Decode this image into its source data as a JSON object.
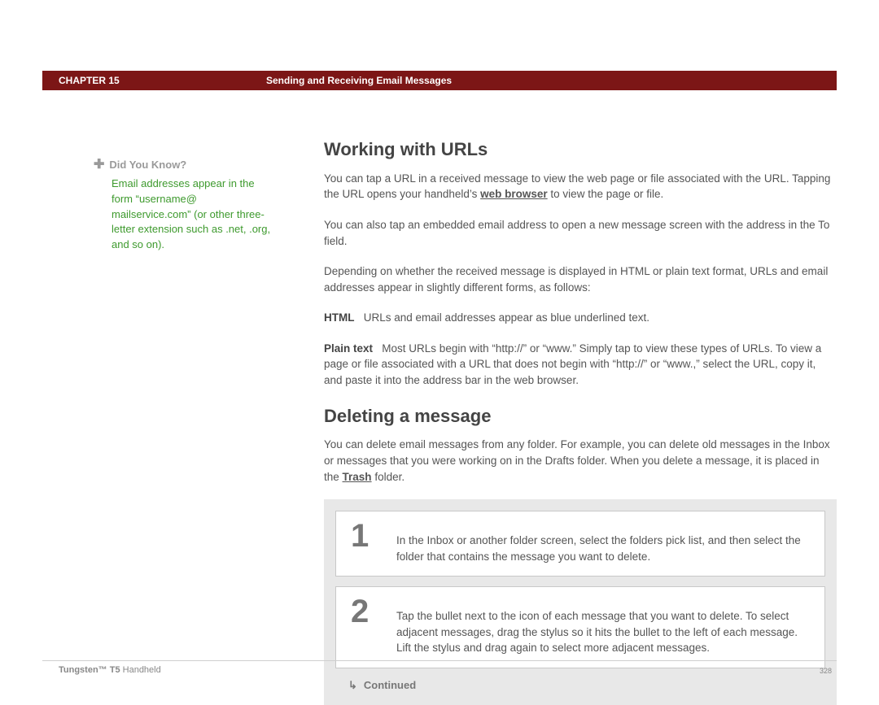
{
  "header": {
    "chapter": "CHAPTER 15",
    "title": "Sending and Receiving Email Messages"
  },
  "sidebar": {
    "dyk_label": "Did You Know?",
    "dyk_body": "Email addresses appear in the form “username@ mailservice.com” (or other three-letter extension such as .net, .org, and so on)."
  },
  "main": {
    "h_urls": "Working with URLs",
    "p_urls_1a": "You can tap a URL in a received message to view the web page or file associated with the URL. Tapping the URL opens your handheld’s ",
    "p_urls_1_link": "web browser",
    "p_urls_1b": " to view the page or file.",
    "p_urls_2": "You can also tap an embedded email address to open a new message screen with the address in the To field.",
    "p_urls_3": "Depending on whether the received message is displayed in HTML or plain text format, URLs and email addresses appear in slightly different forms, as follows:",
    "html_label": "HTML",
    "html_text": "URLs and email addresses appear as blue underlined text.",
    "plain_label": "Plain text",
    "plain_text": "Most URLs begin with “http://” or “www.” Simply tap to view these types of URLs. To view a page or file associated with a URL that does not begin with “http://” or “www.,” select the URL, copy it, and paste it into the address bar in the web browser.",
    "h_delete": "Deleting a message",
    "p_delete_a": "You can delete email messages from any folder. For example, you can delete old messages in the Inbox or messages that you were working on in the Drafts folder. When you delete a message, it is placed in the ",
    "p_delete_link": "Trash",
    "p_delete_b": " folder.",
    "steps": {
      "n1": "1",
      "t1": "In the Inbox or another folder screen, select the folders pick list, and then select the folder that contains the message you want to delete.",
      "n2": "2",
      "t2": "Tap the bullet next to the icon of each message that you want to delete. To select adjacent messages, drag the stylus so it hits the bullet to the left of each message. Lift the stylus and drag again to select more adjacent messages."
    },
    "continued": "Continued"
  },
  "footer": {
    "product_bold": "Tungsten™ T5",
    "product_rest": " Handheld",
    "page": "328"
  }
}
